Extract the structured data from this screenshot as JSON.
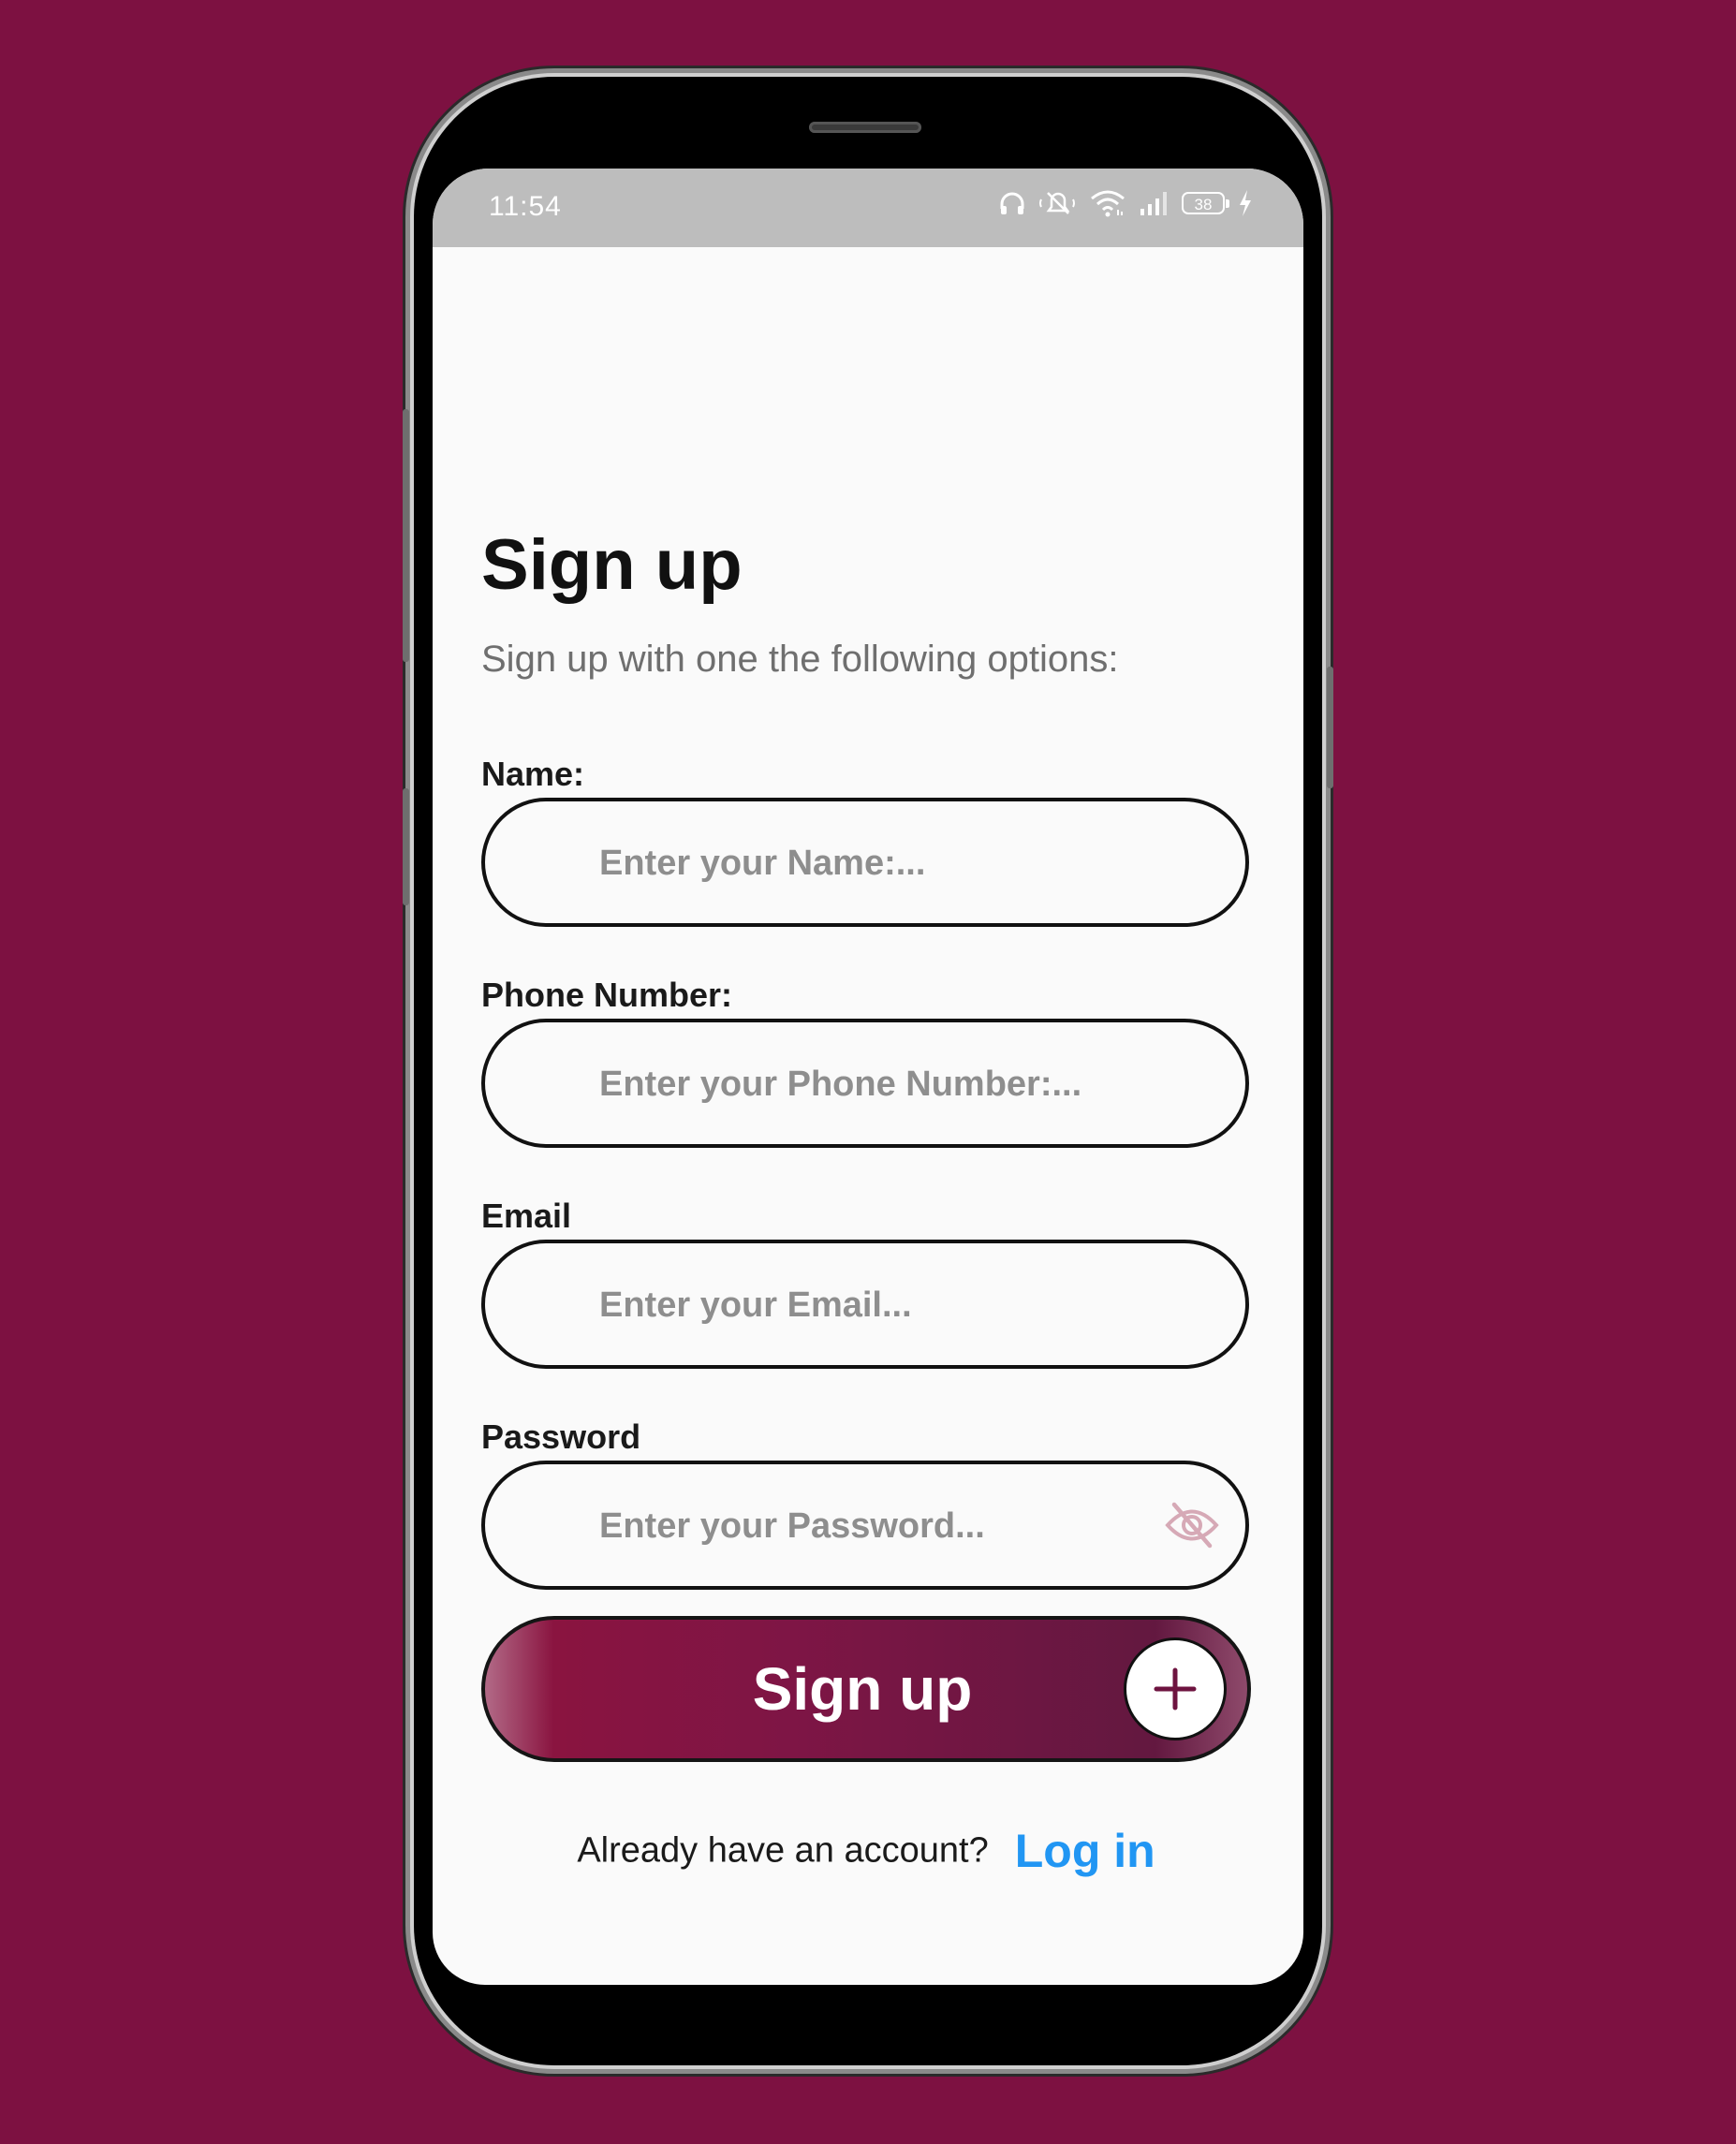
{
  "status_bar": {
    "time": "11:54",
    "battery": "38",
    "icons": [
      "headphones-icon",
      "mute-icon",
      "wifi-icon",
      "signal-icon",
      "battery-icon",
      "charging-icon"
    ]
  },
  "header": {
    "title": "Sign up",
    "subtitle": "Sign up with one the following options:"
  },
  "form": {
    "name": {
      "label": "Name:",
      "placeholder": "Enter your Name:..."
    },
    "phone": {
      "label": "Phone Number:",
      "placeholder": "Enter your Phone Number:..."
    },
    "email": {
      "label": "Email",
      "placeholder": "Enter your Email..."
    },
    "password": {
      "label": "Password",
      "placeholder": "Enter your Password...",
      "icon": "eye-off-icon"
    },
    "submit_label": "Sign up",
    "submit_icon": "plus-icon"
  },
  "footer": {
    "question": "Already have an account?",
    "login_link": "Log in"
  },
  "colors": {
    "background": "#7D1141",
    "accent": "#7E1545",
    "link": "#2196F3",
    "status_bar": "#BDBDBD"
  }
}
